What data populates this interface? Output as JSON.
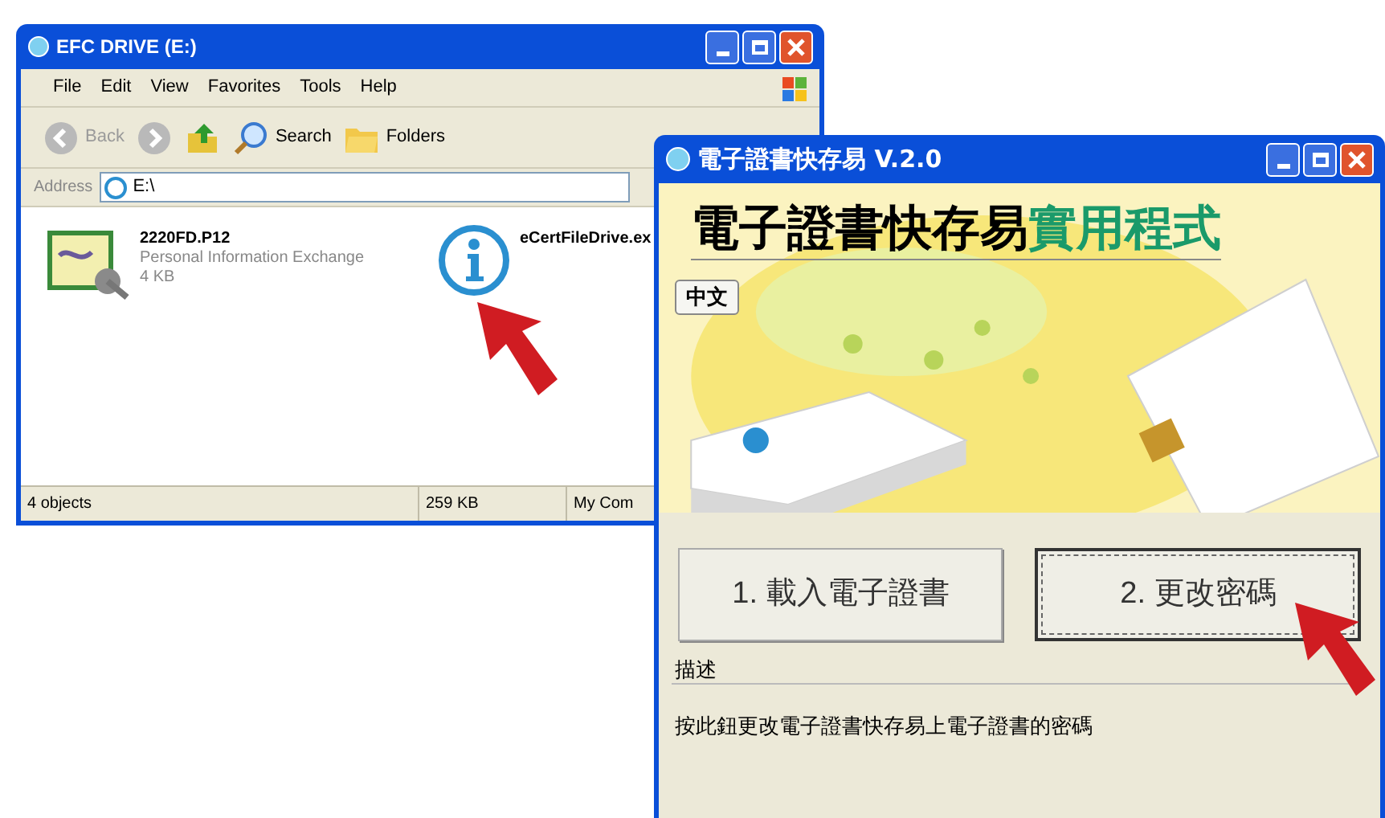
{
  "explorer": {
    "title": "EFC DRIVE (E:)",
    "menu": [
      "File",
      "Edit",
      "View",
      "Favorites",
      "Tools",
      "Help"
    ],
    "toolbar": [
      {
        "kind": "back",
        "label": "Back"
      },
      {
        "kind": "forward"
      },
      {
        "kind": "up"
      },
      {
        "kind": "search",
        "label": "Search"
      },
      {
        "kind": "folders",
        "label": "Folders"
      }
    ],
    "address": {
      "label": "Address",
      "value": "E:\\"
    },
    "files": [
      {
        "kind": "certificate",
        "name": "2220FD.P12",
        "type": "Personal Information Exchange",
        "size": "4 KB"
      },
      {
        "kind": "app",
        "name": "eCertFileDrive.ex"
      }
    ],
    "status_bar": [
      "4 objects",
      "259 KB",
      "My Com"
    ]
  },
  "app": {
    "title": "電子證書快存易 V.2.0",
    "banner": {
      "title": "電子證書快存易",
      "subtitle": "實用程式",
      "language_button": "中文",
      "kind": "picture"
    },
    "buttons": [
      {
        "label": "1. 載入電子證書",
        "selected": false
      },
      {
        "label": "2. 更改密碼",
        "selected": true
      }
    ],
    "description": {
      "label": "描述",
      "text": "按此鈕更改電子證書快存易上電子證書的密碼"
    }
  }
}
